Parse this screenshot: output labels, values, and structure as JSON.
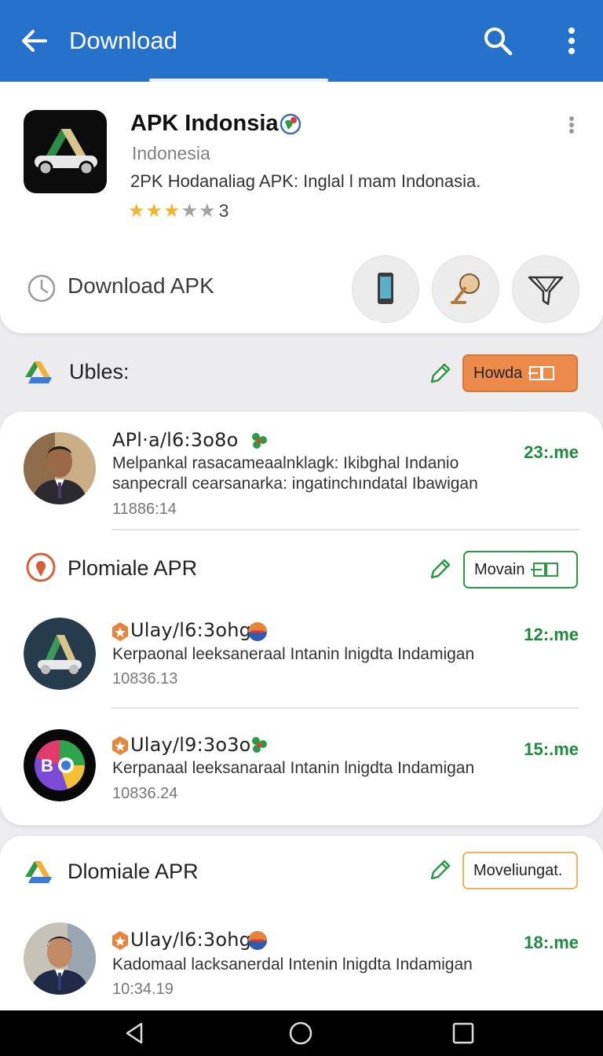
{
  "appbar": {
    "title": "Download",
    "color": "#2671c9"
  },
  "app": {
    "name": "APK Indonsia",
    "region": "Indonesia",
    "description": "2PK Hodanaliag APK: Inglal l mam Indonasia.",
    "rating_stars_filled": 3,
    "rating_stars_total": 5,
    "rating_count": "3"
  },
  "download": {
    "label": "Download APK",
    "actions": [
      "phone-icon",
      "gong-icon",
      "filter-icon"
    ]
  },
  "section1": {
    "title": "Ubles:",
    "chip_label": "Howda"
  },
  "section2": {
    "title": "Plomiale APR",
    "chip_label": "Movain"
  },
  "section3": {
    "title": "Dlomiale APR",
    "chip_label": "Moveliungat."
  },
  "rows": [
    {
      "title": "APl·a/l6:3o8o",
      "line1": "Melpankal rasacameaalnklagk: Ikibghal Indanio",
      "line2": "sanpecrall cearsanarka: ingatinchındatal Ibawigan",
      "meta": "11886:14",
      "time": "23:.me"
    },
    {
      "title": "Ulay/l6:3ohg",
      "line1": "Kerpaonal leeksaneraal Intanin lnigdta Indamigan",
      "meta": "10836.13",
      "time": "12:.me"
    },
    {
      "title": "Ulay/l9:3o3o",
      "line1": "Kerpanaal leeksanaraal Intanin lnigdta Indamigan",
      "meta": "10836.24",
      "time": "15:.me"
    },
    {
      "title": "Ulay/l6:3ohg",
      "line1": "Kadomaal lacksanerdal Intenin lnigdta Indamigan",
      "meta": "10:34.19",
      "time": "18:.me"
    }
  ],
  "colors": {
    "accent": "#2671c9",
    "time_green": "#1e8a3e",
    "chip_orange": "#ec8a4b",
    "chip_green_border": "#2b9a45",
    "chip_outline_border": "#f0b25c"
  }
}
